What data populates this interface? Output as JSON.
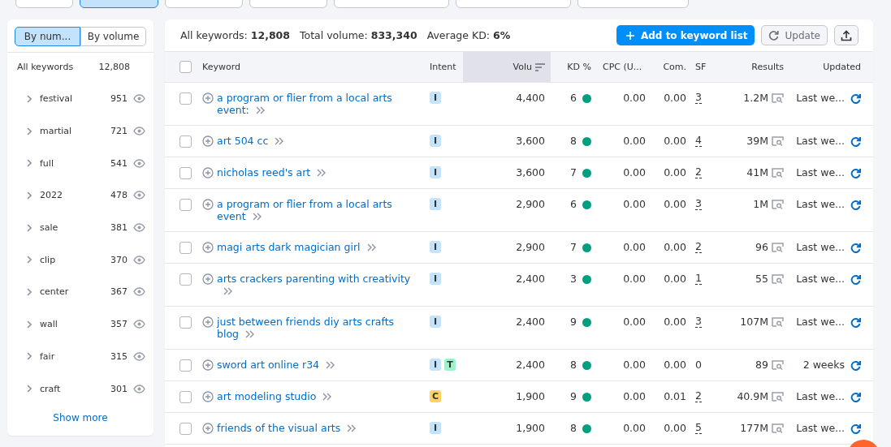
{
  "filter_bar": {
    "buttons": [
      {
        "active": false
      },
      {
        "active": true
      },
      {
        "active": false
      },
      {
        "active": false
      },
      {
        "active": false
      },
      {
        "active": false
      },
      {
        "active": false
      }
    ]
  },
  "sidebar": {
    "tabs": [
      {
        "label": "By num...",
        "selected": true
      },
      {
        "label": "By volume",
        "selected": false
      }
    ],
    "total": {
      "label": "All keywords",
      "count": "12,808"
    },
    "items": [
      {
        "label": "festival",
        "count": "951"
      },
      {
        "label": "martial",
        "count": "721"
      },
      {
        "label": "full",
        "count": "541"
      },
      {
        "label": "2022",
        "count": "478"
      },
      {
        "label": "sale",
        "count": "381"
      },
      {
        "label": "clip",
        "count": "370"
      },
      {
        "label": "center",
        "count": "367"
      },
      {
        "label": "wall",
        "count": "357"
      },
      {
        "label": "fair",
        "count": "315"
      },
      {
        "label": "craft",
        "count": "301"
      }
    ],
    "show_more": "Show more"
  },
  "summary": [
    "All keywords: **12,808**",
    "Total volume: **833,340**",
    "Average KD: **6%**"
  ],
  "actions": {
    "add": "Add to keyword list",
    "update": "Update"
  },
  "table": {
    "select_all": {
      "checked": false
    },
    "columns": [
      {
        "label": "Keyword",
        "sorted": false
      },
      {
        "label": "Intent",
        "sorted": false
      },
      {
        "label": "Volu",
        "sorted": true
      },
      {
        "label": "KD %",
        "sorted": false
      },
      {
        "label": "CPC (U...",
        "sorted": false
      },
      {
        "label": "Com.",
        "sorted": false
      },
      {
        "label": "SF",
        "sorted": false
      },
      {
        "label": "Results",
        "sorted": false
      },
      {
        "label": "Updated",
        "sorted": false
      }
    ],
    "rows": [
      {
        "keyword": "a program or flier from a local arts event:",
        "intent": [
          {
            "label": "I",
            "color": "#c2e3fb"
          }
        ],
        "volume": "4,400",
        "kd": "6",
        "cpc": "0.00",
        "com": "0.00",
        "sf": "3",
        "sf_linked": true,
        "results": "1.2M",
        "updated": "Last we...",
        "checked": false
      },
      {
        "keyword": "art 504 cc",
        "intent": [
          {
            "label": "I",
            "color": "#c2e3fb"
          }
        ],
        "volume": "3,600",
        "kd": "8",
        "cpc": "0.00",
        "com": "0.00",
        "sf": "4",
        "sf_linked": true,
        "results": "39M",
        "updated": "Last we...",
        "checked": false
      },
      {
        "keyword": "nicholas reed's art",
        "intent": [
          {
            "label": "I",
            "color": "#c2e3fb"
          }
        ],
        "volume": "3,600",
        "kd": "7",
        "cpc": "0.00",
        "com": "0.00",
        "sf": "2",
        "sf_linked": true,
        "results": "41M",
        "updated": "Last we...",
        "checked": false
      },
      {
        "keyword": "a program or flier from a local arts event",
        "intent": [
          {
            "label": "I",
            "color": "#c2e3fb"
          }
        ],
        "volume": "2,900",
        "kd": "6",
        "cpc": "0.00",
        "com": "0.00",
        "sf": "3",
        "sf_linked": true,
        "results": "1M",
        "updated": "Last we...",
        "checked": false
      },
      {
        "keyword": "magi arts dark magician girl",
        "intent": [
          {
            "label": "I",
            "color": "#c2e3fb"
          }
        ],
        "volume": "2,900",
        "kd": "7",
        "cpc": "0.00",
        "com": "0.00",
        "sf": "2",
        "sf_linked": true,
        "results": "96",
        "updated": "Last we...",
        "checked": false
      },
      {
        "keyword": "arts crackers parenting with creativity",
        "intent": [
          {
            "label": "I",
            "color": "#c2e3fb"
          }
        ],
        "volume": "2,400",
        "kd": "3",
        "cpc": "0.00",
        "com": "0.00",
        "sf": "1",
        "sf_linked": true,
        "results": "55",
        "updated": "Last we...",
        "checked": false
      },
      {
        "keyword": "just between friends diy arts crafts blog",
        "intent": [
          {
            "label": "I",
            "color": "#c2e3fb"
          }
        ],
        "volume": "2,400",
        "kd": "9",
        "cpc": "0.00",
        "com": "0.00",
        "sf": "3",
        "sf_linked": true,
        "results": "107M",
        "updated": "Last we...",
        "checked": false
      },
      {
        "keyword": "sword art online r34",
        "intent": [
          {
            "label": "I",
            "color": "#c2e3fb"
          },
          {
            "label": "T",
            "color": "#9ef2c9"
          }
        ],
        "volume": "2,400",
        "kd": "8",
        "cpc": "0.00",
        "com": "0.00",
        "sf": "0",
        "sf_linked": false,
        "results": "89",
        "updated": "2 weeks",
        "checked": false
      },
      {
        "keyword": "art modeling studio",
        "intent": [
          {
            "label": "C",
            "color": "#ffd266"
          }
        ],
        "volume": "1,900",
        "kd": "9",
        "cpc": "0.00",
        "com": "0.01",
        "sf": "2",
        "sf_linked": true,
        "results": "40.9M",
        "updated": "Last we...",
        "checked": false
      },
      {
        "keyword": "friends of the visual arts",
        "intent": [
          {
            "label": "I",
            "color": "#c2e3fb"
          }
        ],
        "volume": "1,900",
        "kd": "8",
        "cpc": "0.00",
        "com": "0.00",
        "sf": "5",
        "sf_linked": true,
        "results": "177M",
        "updated": "Last we...",
        "checked": false
      }
    ]
  }
}
